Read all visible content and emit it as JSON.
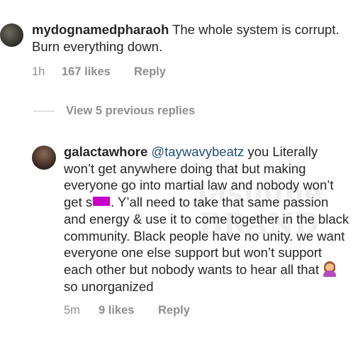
{
  "watermark": {
    "line1": "Jasmine",
    "line2": "BRAND"
  },
  "comments": [
    {
      "username": "mydognamedpharaoh",
      "text": "The whole system is corrupt. Burn everything down.",
      "time": "1h",
      "likes": "167 likes",
      "reply": "Reply"
    },
    {
      "username": "galactawhore",
      "mention": "@taywavybeatz",
      "text_part1": "you Literally won’t get anywhere doing that but making everyone go into martial law and nobody won’t get s",
      "text_part2": ". Y’all need to take that same passion and energy & use it to come together in the black community. Black people have no unity. we want everyone one else support but won’t support each other but nobody wants to hear all that",
      "text_part3": "so unorganized",
      "emoji": "woman-raising-hand-emoji",
      "censor_color": "#c800c8",
      "time": "5m",
      "likes": "9 likes",
      "reply": "Reply"
    }
  ],
  "view_replies": "View 5 previous replies"
}
